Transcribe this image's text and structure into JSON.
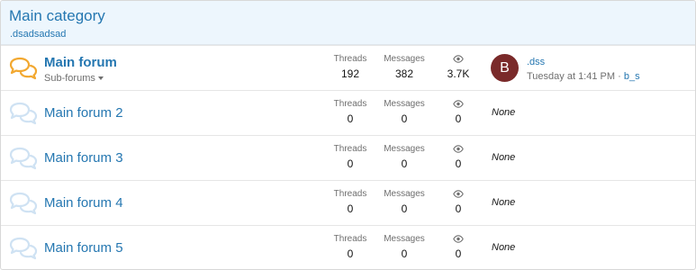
{
  "category": {
    "title": "Main category",
    "description": ".dsadsadsad"
  },
  "nodes": [
    {
      "title": "Main forum",
      "unread": true,
      "subforums_label": "Sub-forums",
      "threads_label": "Threads",
      "threads": "192",
      "messages_label": "Messages",
      "messages": "382",
      "views": "3.7K",
      "last_post": {
        "avatar_letter": "B",
        "avatar_color": "#7a2a2a",
        "title": ".dss",
        "time": "Tuesday at 1:41 PM",
        "separator": "·",
        "user": "b_s"
      }
    },
    {
      "title": "Main forum 2",
      "threads_label": "Threads",
      "threads": "0",
      "messages_label": "Messages",
      "messages": "0",
      "views": "0",
      "extra": "None"
    },
    {
      "title": "Main forum 3",
      "threads_label": "Threads",
      "threads": "0",
      "messages_label": "Messages",
      "messages": "0",
      "views": "0",
      "extra": "None"
    },
    {
      "title": "Main forum 4",
      "threads_label": "Threads",
      "threads": "0",
      "messages_label": "Messages",
      "messages": "0",
      "views": "0",
      "extra": "None"
    },
    {
      "title": "Main forum 5",
      "threads_label": "Threads",
      "threads": "0",
      "messages_label": "Messages",
      "messages": "0",
      "views": "0",
      "extra": "None"
    }
  ],
  "colors": {
    "link": "#2577b1",
    "header_bg": "#edf6fd",
    "icon_unread": "#f2a830",
    "icon_read": "#cfe2f3"
  },
  "icons": {
    "forum_unread": "chat-bubbles-icon",
    "forum_read": "chat-bubbles-icon",
    "views": "eye-icon"
  }
}
